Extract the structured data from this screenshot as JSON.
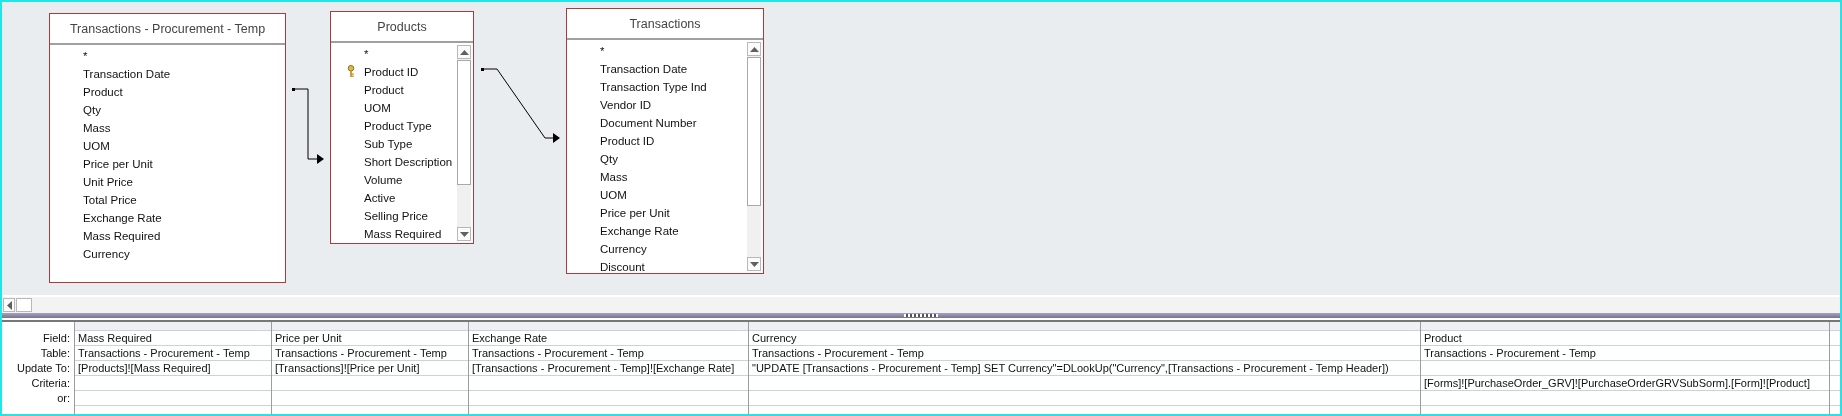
{
  "tables": [
    {
      "title": "Transactions - Procurement - Temp",
      "scrollable": false,
      "fields": [
        {
          "name": "*",
          "primary_key": false
        },
        {
          "name": "Transaction Date",
          "primary_key": false
        },
        {
          "name": "Product",
          "primary_key": false
        },
        {
          "name": "Qty",
          "primary_key": false
        },
        {
          "name": "Mass",
          "primary_key": false
        },
        {
          "name": "UOM",
          "primary_key": false
        },
        {
          "name": "Price per Unit",
          "primary_key": false
        },
        {
          "name": "Unit Price",
          "primary_key": false
        },
        {
          "name": "Total Price",
          "primary_key": false
        },
        {
          "name": "Exchange Rate",
          "primary_key": false
        },
        {
          "name": "Mass Required",
          "primary_key": false
        },
        {
          "name": "Currency",
          "primary_key": false
        }
      ]
    },
    {
      "title": "Products",
      "scrollable": true,
      "fields": [
        {
          "name": "*",
          "primary_key": false
        },
        {
          "name": "Product ID",
          "primary_key": true
        },
        {
          "name": "Product",
          "primary_key": false
        },
        {
          "name": "UOM",
          "primary_key": false
        },
        {
          "name": "Product Type",
          "primary_key": false
        },
        {
          "name": "Sub Type",
          "primary_key": false
        },
        {
          "name": "Short Description",
          "primary_key": false
        },
        {
          "name": "Volume",
          "primary_key": false
        },
        {
          "name": "Active",
          "primary_key": false
        },
        {
          "name": "Selling Price",
          "primary_key": false
        },
        {
          "name": "Mass Required",
          "primary_key": false
        }
      ]
    },
    {
      "title": "Transactions",
      "scrollable": true,
      "fields": [
        {
          "name": "*",
          "primary_key": false
        },
        {
          "name": "Transaction Date",
          "primary_key": false
        },
        {
          "name": "Transaction Type Ind",
          "primary_key": false
        },
        {
          "name": "Vendor ID",
          "primary_key": false
        },
        {
          "name": "Document Number",
          "primary_key": false
        },
        {
          "name": "Product ID",
          "primary_key": false
        },
        {
          "name": "Qty",
          "primary_key": false
        },
        {
          "name": "Mass",
          "primary_key": false
        },
        {
          "name": "UOM",
          "primary_key": false
        },
        {
          "name": "Price per Unit",
          "primary_key": false
        },
        {
          "name": "Exchange Rate",
          "primary_key": false
        },
        {
          "name": "Currency",
          "primary_key": false
        },
        {
          "name": "Discount",
          "primary_key": false
        }
      ]
    }
  ],
  "grid": {
    "row_labels": [
      "Field:",
      "Table:",
      "Update To:",
      "Criteria:",
      "or:"
    ],
    "columns": [
      {
        "field": "Mass Required",
        "table": "Transactions - Procurement - Temp",
        "update_to": "[Products]![Mass Required]"
      },
      {
        "field": "Price per Unit",
        "table": "Transactions - Procurement - Temp",
        "update_to": "[Transactions]![Price per Unit]"
      },
      {
        "field": "Exchange Rate",
        "table": "Transactions - Procurement - Temp",
        "update_to": "[Transactions - Procurement - Temp]![Exchange Rate]"
      },
      {
        "field": "Currency",
        "table": "Transactions - Procurement - Temp",
        "update_to": "\"UPDATE [Transactions - Procurement - Temp] SET Currency\"=DLookUp(\"Currency\",[Transactions - Procurement - Temp Header])"
      },
      {
        "field": "Product",
        "table": "Transactions - Procurement - Temp",
        "criteria": "[Forms]![PurchaseOrder_GRV]![PurchaseOrderGRVSubSorm].[Form]![Product]"
      }
    ]
  }
}
